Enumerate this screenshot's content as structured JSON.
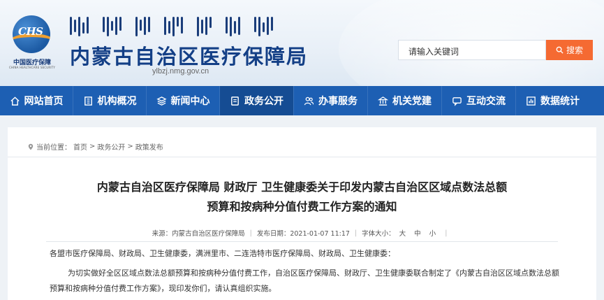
{
  "header": {
    "site_title": "内蒙古自治区医疗保障局",
    "domain": "ylbzj.nmg.gov.cn",
    "logo": {
      "abbr": "CHS",
      "name_cn": "中国医疗保障",
      "name_en": "CHINA HEALTHCARE SECURITY"
    },
    "search": {
      "placeholder": "请输入关键词",
      "button_label": "搜索"
    }
  },
  "nav": {
    "items": [
      {
        "label": "网站首页",
        "icon": "home-icon"
      },
      {
        "label": "机构概况",
        "icon": "building-icon"
      },
      {
        "label": "新闻中心",
        "icon": "layers-icon"
      },
      {
        "label": "政务公开",
        "icon": "document-icon",
        "active": true
      },
      {
        "label": "办事服务",
        "icon": "people-icon"
      },
      {
        "label": "机关党建",
        "icon": "institution-icon"
      },
      {
        "label": "互动交流",
        "icon": "chat-icon"
      },
      {
        "label": "数据统计",
        "icon": "chart-icon"
      }
    ]
  },
  "breadcrumb": {
    "prefix": "当前位置：",
    "items": [
      "首页",
      "政务公开",
      "政策发布"
    ],
    "separator": ">"
  },
  "article": {
    "title_line1": "内蒙古自治区医疗保障局 财政厅 卫生健康委关于印发内蒙古自治区区域点数法总额",
    "title_line2": "预算和按病种分值付费工作方案的通知",
    "meta": {
      "source": "来源：内蒙古自治区医疗保障局",
      "date": "发布日期：2021-01-07 11:17",
      "font_size_label": "字体大小：",
      "sizes": [
        "大",
        "中",
        "小"
      ]
    },
    "para1": "各盟市医疗保障局、财政局、卫生健康委，满洲里市、二连浩特市医疗保障局、财政局、卫生健康委：",
    "para2": "为切实做好全区区域点数法总额预算和按病种分值付费工作，自治区医疗保障局、财政厅、卫生健康委联合制定了《内蒙古自治区区域点数法总额预算和按病种分值付费工作方案》，现印发你们，请认真组织实施。"
  },
  "colors": {
    "nav_bg": "#1d5fb3",
    "nav_active": "#154c93",
    "title_blue": "#133f86",
    "search_button": "#f56a32"
  }
}
